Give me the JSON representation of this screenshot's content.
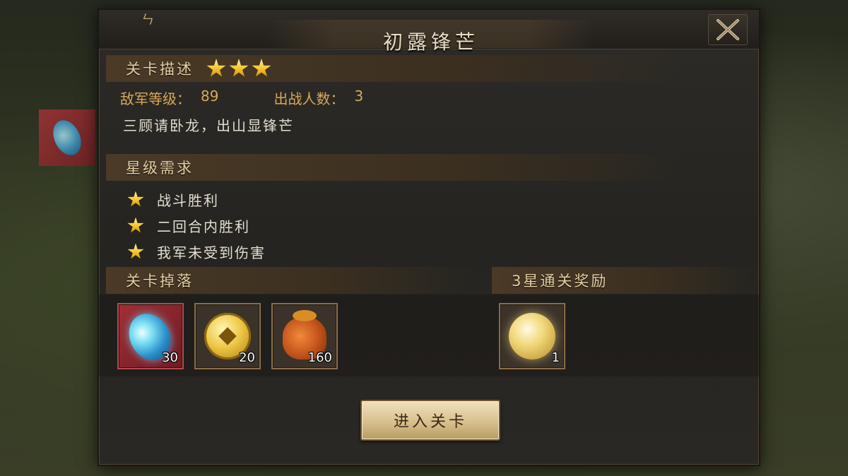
{
  "dialog": {
    "title": "初露锋芒",
    "title_hook": "ㄣ"
  },
  "level_desc": {
    "header": "关卡描述",
    "stars": 3,
    "enemy_level_label": "敌军等级：",
    "enemy_level_value": "89",
    "deploy_count_label": "出战人数：",
    "deploy_count_value": "3",
    "description": "三顾请卧龙，出山显锋芒"
  },
  "star_requirements": {
    "header": "星级需求",
    "items": [
      {
        "label": "战斗胜利"
      },
      {
        "label": "二回合内胜利"
      },
      {
        "label": "我军未受到伤害"
      }
    ]
  },
  "drops": {
    "header": "关卡掉落",
    "items": [
      {
        "icon": "blue-gem-icon",
        "count": "30"
      },
      {
        "icon": "gold-coin-icon",
        "count": "20"
      },
      {
        "icon": "coin-bag-icon",
        "count": "160"
      }
    ]
  },
  "three_star_reward": {
    "header": "3星通关奖励",
    "items": [
      {
        "icon": "golden-orb-icon",
        "count": "1"
      }
    ]
  },
  "enter_button": {
    "label": "进入关卡"
  },
  "colors": {
    "header_text": "#e6cfa3",
    "info_text": "#d7a85a",
    "body_text": "#e4ddd0",
    "star": "#f5c52c"
  }
}
